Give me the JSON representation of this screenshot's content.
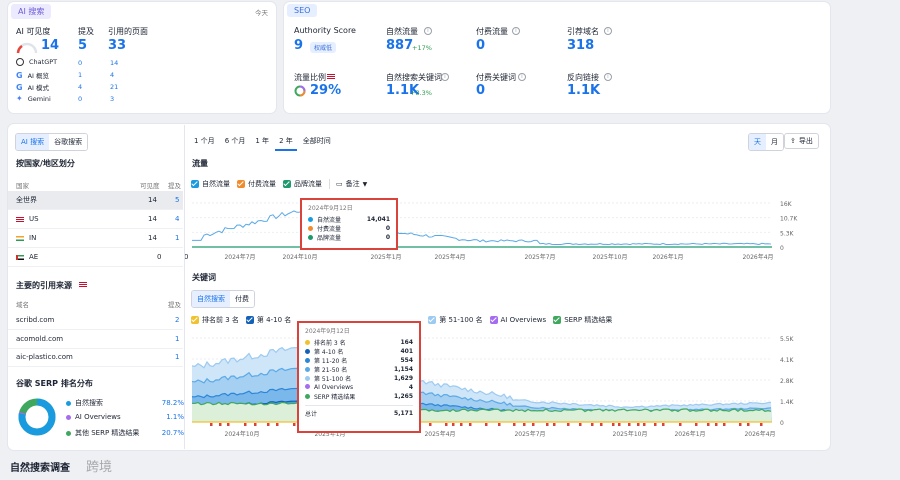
{
  "ai_card": {
    "tag": "AI 搜索",
    "today": "今天",
    "visibility_label": "AI 可见度",
    "mentions_label": "提及",
    "cited_label": "引用的页面",
    "visibility": "14",
    "mentions": "5",
    "cited": "33",
    "rows": [
      {
        "name": "ChatGPT",
        "a": "0",
        "b": "14"
      },
      {
        "name": "AI 概览",
        "a": "1",
        "b": "4"
      },
      {
        "name": "AI 模式",
        "a": "4",
        "b": "21"
      },
      {
        "name": "Gemini",
        "a": "0",
        "b": "3"
      }
    ]
  },
  "seo_card": {
    "tag": "SEO",
    "authority_label": "Authority Score",
    "authority": "9",
    "authority_badge": "权威低",
    "organic_label": "自然流量",
    "organic": "887",
    "organic_change": "+17%",
    "paid_label": "付费流量",
    "paid": "0",
    "ref_domains_label": "引荐域名",
    "ref_domains": "318",
    "share_label": "流量比例",
    "share": "29%",
    "org_kw_label": "自然搜索关键词",
    "org_kw": "1.1K",
    "org_kw_change": "+3.3%",
    "paid_kw_label": "付费关键词",
    "paid_kw": "0",
    "backlinks_label": "反向链接",
    "backlinks": "1.1K"
  },
  "left_panel": {
    "tab_ai": "AI 搜索",
    "tab_google": "谷歌搜索",
    "country_title": "按国家/地区划分",
    "col_country": "国家",
    "col_visibility": "可见度",
    "col_mentions": "提及",
    "countries": [
      {
        "name": "全世界",
        "v": "14",
        "m": "5"
      },
      {
        "name": "US",
        "v": "14",
        "m": "4"
      },
      {
        "name": "IN",
        "v": "14",
        "m": "1"
      },
      {
        "name": "AE",
        "v": "0",
        "m": "0"
      }
    ],
    "sources_title": "主要的引用来源",
    "col_domain": "域名",
    "col_mention": "提及",
    "sources": [
      {
        "d": "scribd.com",
        "m": "2"
      },
      {
        "d": "acomold.com",
        "m": "1"
      },
      {
        "d": "aic-plastico.com",
        "m": "1"
      }
    ],
    "serp_title": "谷歌 SERP 排名分布",
    "serp": [
      {
        "label": "自然搜索",
        "value": "78.2%",
        "color": "#1a9be0"
      },
      {
        "label": "AI Overviews",
        "value": "1.1%",
        "color": "#a56cf0"
      },
      {
        "label": "其他 SERP 精选结果",
        "value": "20.7%",
        "color": "#3fa85e"
      }
    ]
  },
  "range_tabs": [
    "1 个月",
    "6 个月",
    "1 年",
    "2 年",
    "全部时间"
  ],
  "active_range": "2 年",
  "toggle_day": "天",
  "toggle_month": "月",
  "export_label": "导出",
  "traffic": {
    "title": "流量",
    "legend": [
      {
        "label": "自然流量",
        "color": "#1a9be0"
      },
      {
        "label": "付费流量",
        "color": "#f08c2e"
      },
      {
        "label": "品牌流量",
        "color": "#1d9a6c"
      }
    ],
    "notes_label": "备注",
    "y_ticks": [
      "16K",
      "10.7K",
      "5.3K",
      "0"
    ],
    "x_ticks": [
      "2024年7月",
      "2024年10月",
      "2025年1月",
      "2025年4月",
      "2025年7月",
      "2025年10月",
      "2026年1月",
      "2026年4月"
    ],
    "tooltip": {
      "date": "2024年9月12日",
      "rows": [
        {
          "label": "自然流量",
          "value": "14,041",
          "color": "#1a9be0"
        },
        {
          "label": "付费流量",
          "value": "0",
          "color": "#f08c2e"
        },
        {
          "label": "品牌流量",
          "value": "0",
          "color": "#1d9a6c"
        }
      ]
    }
  },
  "keywords": {
    "title": "关键词",
    "tab_organic": "自然搜索",
    "tab_paid": "付费",
    "legend": [
      {
        "label": "排名前 3 名",
        "color": "#f2c12e"
      },
      {
        "label": "第 4-10 名",
        "color": "#1561b8"
      },
      {
        "label": "第 51-100 名",
        "color": "#9ccaf0"
      },
      {
        "label": "AI Overviews",
        "color": "#a56cf0"
      },
      {
        "label": "SERP 精选结果",
        "color": "#3fa85e"
      }
    ],
    "y_ticks": [
      "5.5K",
      "4.1K",
      "2.8K",
      "1.4K",
      "0"
    ],
    "x_ticks": [
      "2024年10月",
      "2025年1月",
      "2025年4月",
      "2025年7月",
      "2025年10月",
      "2026年1月",
      "2026年4月"
    ],
    "tooltip": {
      "date": "2024年9月12日",
      "rows": [
        {
          "label": "排名前 3 名",
          "value": "164",
          "color": "#f2c12e"
        },
        {
          "label": "第 4-10 名",
          "value": "401",
          "color": "#1561b8"
        },
        {
          "label": "第 11-20 名",
          "value": "554",
          "color": "#2c86d6"
        },
        {
          "label": "第 21-50 名",
          "value": "1,154",
          "color": "#5aa9e6"
        },
        {
          "label": "第 51-100 名",
          "value": "1,629",
          "color": "#9ccaf0"
        },
        {
          "label": "AI Overviews",
          "value": "4",
          "color": "#a56cf0"
        },
        {
          "label": "SERP 精选结果",
          "value": "1,265",
          "color": "#3fa85e"
        }
      ],
      "total_label": "总计",
      "total": "5,171"
    }
  },
  "bottom_title": "自然搜索调查",
  "watermark": "跨境"
}
